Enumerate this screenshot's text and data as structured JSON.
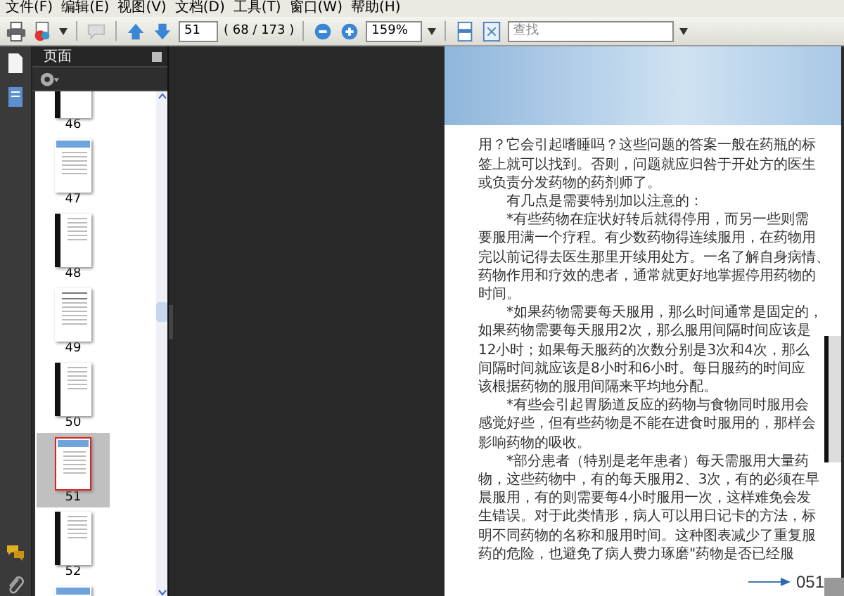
{
  "menu": [
    "文件(F)",
    "编辑(E)",
    "视图(V)",
    "文档(D)",
    "工具(T)",
    "窗口(W)",
    "帮助(H)"
  ],
  "toolbar": {
    "page_field": "51",
    "page_count": "( 68 / 173 )",
    "zoom_field": "159%",
    "search": {
      "placeholder": "查找"
    }
  },
  "panel": {
    "title": "页面",
    "pages": [
      {
        "label": "46",
        "kind": "dark",
        "selected": false
      },
      {
        "label": "47",
        "kind": "blue",
        "selected": false
      },
      {
        "label": "48",
        "kind": "dark",
        "selected": false
      },
      {
        "label": "49",
        "kind": "plain",
        "selected": false
      },
      {
        "label": "50",
        "kind": "dark",
        "selected": false
      },
      {
        "label": "51",
        "kind": "blue",
        "selected": true
      },
      {
        "label": "52",
        "kind": "dark",
        "selected": false
      },
      {
        "kind": "blue",
        "selected": false
      }
    ]
  },
  "document": {
    "lines": [
      {
        "text": "用？它会引起嗜睡吗？这些问题的答案一般在药瓶的标",
        "indent": false
      },
      {
        "text": "签上就可以找到。否则，问题就应归咎于开处方的医生",
        "indent": false
      },
      {
        "text": "或负责分发药物的药剂师了。",
        "indent": false
      },
      {
        "text": "有几点是需要特别加以注意的：",
        "indent": true
      },
      {
        "text": "*有些药物在症状好转后就得停用，而另一些则需",
        "indent": true
      },
      {
        "text": "要服用满一个疗程。有少数药物得连续服用，在药物用",
        "indent": false
      },
      {
        "text": "完以前记得去医生那里开续用处方。一名了解自身病情、",
        "indent": false
      },
      {
        "text": "药物作用和疗效的患者，通常就更好地掌握停用药物的",
        "indent": false
      },
      {
        "text": "时间。",
        "indent": false
      },
      {
        "text": "*如果药物需要每天服用，那么时间通常是固定的，",
        "indent": true
      },
      {
        "text": "如果药物需要每天服用2次，那么服用间隔时间应该是",
        "indent": false
      },
      {
        "text": "12小时；如果每天服药的次数分别是3次和4次，那么",
        "indent": false
      },
      {
        "text": "间隔时间就应该是8小时和6小时。每日服药的时间应",
        "indent": false
      },
      {
        "text": "该根据药物的服用间隔来平均地分配。",
        "indent": false
      },
      {
        "text": "*有些会引起胃肠道反应的药物与食物同时服用会",
        "indent": true
      },
      {
        "text": "感觉好些，但有些药物是不能在进食时服用的，那样会",
        "indent": false
      },
      {
        "text": "影响药物的吸收。",
        "indent": false
      },
      {
        "text": "*部分患者（特别是老年患者）每天需服用大量药",
        "indent": true
      },
      {
        "text": "物，这些药物中，有的每天服用2、3次，有的必须在早",
        "indent": false
      },
      {
        "text": "晨服用，有的则需要每4小时服用一次，这样难免会发",
        "indent": false
      },
      {
        "text": "生错误。对于此类情形，病人可以用日记卡的方法，标",
        "indent": false
      },
      {
        "text": "明不同药物的名称和服用时间。这种图表减少了重复服",
        "indent": false
      },
      {
        "text": "药的危险，也避免了病人费力琢磨\"药物是否已经服",
        "indent": false
      }
    ],
    "page_number": "051"
  }
}
